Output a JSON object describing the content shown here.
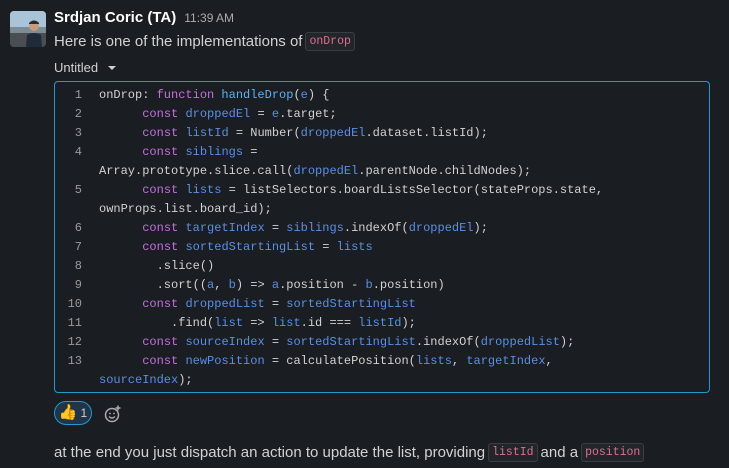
{
  "message": {
    "author": "Srdjan Coric (TA)",
    "time": "11:39 AM",
    "text_before": "Here is one of the implementations of",
    "code_term": "onDrop"
  },
  "snippet": {
    "title": "Untitled",
    "lines": [
      {
        "n": "1",
        "parts": [
          [
            "p",
            "onDrop: "
          ],
          [
            "k",
            "function"
          ],
          [
            "p",
            " "
          ],
          [
            "f",
            "handleDrop"
          ],
          [
            "p",
            "("
          ],
          [
            "v",
            "e"
          ],
          [
            "p",
            ") {"
          ]
        ]
      },
      {
        "n": "2",
        "parts": [
          [
            "p",
            "      "
          ],
          [
            "k",
            "const"
          ],
          [
            "p",
            " "
          ],
          [
            "v",
            "droppedEl"
          ],
          [
            "p",
            " = "
          ],
          [
            "v",
            "e"
          ],
          [
            "p",
            ".target;"
          ]
        ]
      },
      {
        "n": "3",
        "parts": [
          [
            "p",
            "      "
          ],
          [
            "k",
            "const"
          ],
          [
            "p",
            " "
          ],
          [
            "v",
            "listId"
          ],
          [
            "p",
            " = Number("
          ],
          [
            "v",
            "droppedEl"
          ],
          [
            "p",
            ".dataset.listId);"
          ]
        ]
      },
      {
        "n": "4",
        "parts": [
          [
            "p",
            "      "
          ],
          [
            "k",
            "const"
          ],
          [
            "p",
            " "
          ],
          [
            "v",
            "siblings"
          ],
          [
            "p",
            " ="
          ]
        ]
      },
      {
        "n": "",
        "parts": [
          [
            "p",
            "Array.prototype.slice.call("
          ],
          [
            "v",
            "droppedEl"
          ],
          [
            "p",
            ".parentNode.childNodes);"
          ]
        ]
      },
      {
        "n": "5",
        "parts": [
          [
            "p",
            "      "
          ],
          [
            "k",
            "const"
          ],
          [
            "p",
            " "
          ],
          [
            "v",
            "lists"
          ],
          [
            "p",
            " = listSelectors.boardListsSelector(stateProps.state,"
          ]
        ]
      },
      {
        "n": "",
        "parts": [
          [
            "p",
            "ownProps.list.board_id);"
          ]
        ]
      },
      {
        "n": "6",
        "parts": [
          [
            "p",
            "      "
          ],
          [
            "k",
            "const"
          ],
          [
            "p",
            " "
          ],
          [
            "v",
            "targetIndex"
          ],
          [
            "p",
            " = "
          ],
          [
            "v",
            "siblings"
          ],
          [
            "p",
            ".indexOf("
          ],
          [
            "v",
            "droppedEl"
          ],
          [
            "p",
            ");"
          ]
        ]
      },
      {
        "n": "7",
        "parts": [
          [
            "p",
            "      "
          ],
          [
            "k",
            "const"
          ],
          [
            "p",
            " "
          ],
          [
            "v",
            "sortedStartingList"
          ],
          [
            "p",
            " = "
          ],
          [
            "v",
            "lists"
          ]
        ]
      },
      {
        "n": "8",
        "parts": [
          [
            "p",
            "        .slice()"
          ]
        ]
      },
      {
        "n": "9",
        "parts": [
          [
            "p",
            "        .sort(("
          ],
          [
            "v",
            "a"
          ],
          [
            "p",
            ", "
          ],
          [
            "v",
            "b"
          ],
          [
            "p",
            ") => "
          ],
          [
            "v",
            "a"
          ],
          [
            "p",
            ".position - "
          ],
          [
            "v",
            "b"
          ],
          [
            "p",
            ".position)"
          ]
        ]
      },
      {
        "n": "10",
        "parts": [
          [
            "p",
            "      "
          ],
          [
            "k",
            "const"
          ],
          [
            "p",
            " "
          ],
          [
            "v",
            "droppedList"
          ],
          [
            "p",
            " = "
          ],
          [
            "v",
            "sortedStartingList"
          ]
        ]
      },
      {
        "n": "11",
        "parts": [
          [
            "p",
            "          .find("
          ],
          [
            "v",
            "list"
          ],
          [
            "p",
            " => "
          ],
          [
            "v",
            "list"
          ],
          [
            "p",
            ".id === "
          ],
          [
            "v",
            "listId"
          ],
          [
            "p",
            ");"
          ]
        ]
      },
      {
        "n": "12",
        "parts": [
          [
            "p",
            "      "
          ],
          [
            "k",
            "const"
          ],
          [
            "p",
            " "
          ],
          [
            "v",
            "sourceIndex"
          ],
          [
            "p",
            " = "
          ],
          [
            "v",
            "sortedStartingList"
          ],
          [
            "p",
            ".indexOf("
          ],
          [
            "v",
            "droppedList"
          ],
          [
            "p",
            ");"
          ]
        ]
      },
      {
        "n": "13",
        "parts": [
          [
            "p",
            "      "
          ],
          [
            "k",
            "const"
          ],
          [
            "p",
            " "
          ],
          [
            "v",
            "newPosition"
          ],
          [
            "p",
            " = calculatePosition("
          ],
          [
            "v",
            "lists"
          ],
          [
            "p",
            ", "
          ],
          [
            "v",
            "targetIndex"
          ],
          [
            "p",
            ","
          ]
        ]
      },
      {
        "n": "",
        "parts": [
          [
            "v",
            "sourceIndex"
          ],
          [
            "p",
            ");"
          ]
        ]
      }
    ]
  },
  "reaction": {
    "emoji": "👍",
    "count": "1",
    "add_icon": "add-reaction-icon"
  },
  "followup": {
    "text_1": "at the end you just dispatch an action to update the list, providing",
    "code_1": "listId",
    "text_2": "and a",
    "code_2": "position"
  },
  "colors": {
    "background": "#1a1d21",
    "accent": "#1d9bd1",
    "keyword": "#c56ee0",
    "function": "#5eb1ef",
    "variable": "#5b8fe6",
    "inline_code": "#e06c94"
  }
}
